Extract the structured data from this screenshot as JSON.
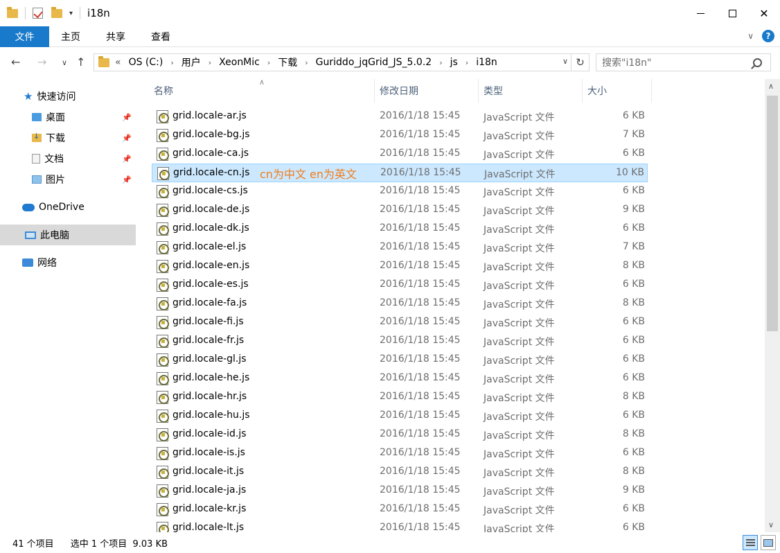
{
  "window": {
    "title": "i18n"
  },
  "ribbon": {
    "file": "文件",
    "tabs": [
      "主页",
      "共享",
      "查看"
    ]
  },
  "address": {
    "overflow": "«",
    "crumbs": [
      "OS (C:)",
      "用户",
      "XeonMic",
      "下载",
      "Guriddo_jqGrid_JS_5.0.2",
      "js",
      "i18n"
    ]
  },
  "search": {
    "placeholder": "搜索\"i18n\""
  },
  "nav": {
    "quick_access": "快速访问",
    "desktop": "桌面",
    "downloads": "下载",
    "documents": "文档",
    "pictures": "图片",
    "onedrive": "OneDrive",
    "this_pc": "此电脑",
    "network": "网络"
  },
  "columns": {
    "name": "名称",
    "date": "修改日期",
    "type": "类型",
    "size": "大小"
  },
  "annotation": "cn为中文 en为英文",
  "files": [
    {
      "name": "grid.locale-ar.js",
      "date": "2016/1/18 15:45",
      "type": "JavaScript 文件",
      "size": "6 KB"
    },
    {
      "name": "grid.locale-bg.js",
      "date": "2016/1/18 15:45",
      "type": "JavaScript 文件",
      "size": "7 KB"
    },
    {
      "name": "grid.locale-ca.js",
      "date": "2016/1/18 15:45",
      "type": "JavaScript 文件",
      "size": "6 KB"
    },
    {
      "name": "grid.locale-cn.js",
      "date": "2016/1/18 15:45",
      "type": "JavaScript 文件",
      "size": "10 KB"
    },
    {
      "name": "grid.locale-cs.js",
      "date": "2016/1/18 15:45",
      "type": "JavaScript 文件",
      "size": "6 KB"
    },
    {
      "name": "grid.locale-de.js",
      "date": "2016/1/18 15:45",
      "type": "JavaScript 文件",
      "size": "9 KB"
    },
    {
      "name": "grid.locale-dk.js",
      "date": "2016/1/18 15:45",
      "type": "JavaScript 文件",
      "size": "6 KB"
    },
    {
      "name": "grid.locale-el.js",
      "date": "2016/1/18 15:45",
      "type": "JavaScript 文件",
      "size": "7 KB"
    },
    {
      "name": "grid.locale-en.js",
      "date": "2016/1/18 15:45",
      "type": "JavaScript 文件",
      "size": "8 KB"
    },
    {
      "name": "grid.locale-es.js",
      "date": "2016/1/18 15:45",
      "type": "JavaScript 文件",
      "size": "6 KB"
    },
    {
      "name": "grid.locale-fa.js",
      "date": "2016/1/18 15:45",
      "type": "JavaScript 文件",
      "size": "8 KB"
    },
    {
      "name": "grid.locale-fi.js",
      "date": "2016/1/18 15:45",
      "type": "JavaScript 文件",
      "size": "6 KB"
    },
    {
      "name": "grid.locale-fr.js",
      "date": "2016/1/18 15:45",
      "type": "JavaScript 文件",
      "size": "6 KB"
    },
    {
      "name": "grid.locale-gl.js",
      "date": "2016/1/18 15:45",
      "type": "JavaScript 文件",
      "size": "6 KB"
    },
    {
      "name": "grid.locale-he.js",
      "date": "2016/1/18 15:45",
      "type": "JavaScript 文件",
      "size": "6 KB"
    },
    {
      "name": "grid.locale-hr.js",
      "date": "2016/1/18 15:45",
      "type": "JavaScript 文件",
      "size": "8 KB"
    },
    {
      "name": "grid.locale-hu.js",
      "date": "2016/1/18 15:45",
      "type": "JavaScript 文件",
      "size": "6 KB"
    },
    {
      "name": "grid.locale-id.js",
      "date": "2016/1/18 15:45",
      "type": "JavaScript 文件",
      "size": "8 KB"
    },
    {
      "name": "grid.locale-is.js",
      "date": "2016/1/18 15:45",
      "type": "JavaScript 文件",
      "size": "6 KB"
    },
    {
      "name": "grid.locale-it.js",
      "date": "2016/1/18 15:45",
      "type": "JavaScript 文件",
      "size": "8 KB"
    },
    {
      "name": "grid.locale-ja.js",
      "date": "2016/1/18 15:45",
      "type": "JavaScript 文件",
      "size": "9 KB"
    },
    {
      "name": "grid.locale-kr.js",
      "date": "2016/1/18 15:45",
      "type": "JavaScript 文件",
      "size": "6 KB"
    },
    {
      "name": "grid.locale-lt.js",
      "date": "2016/1/18 15:45",
      "type": "JavaScript 文件",
      "size": "6 KB"
    }
  ],
  "selected_index": 3,
  "status": {
    "count": "41 个项目",
    "selection": "选中 1 个项目  9.03 KB"
  }
}
